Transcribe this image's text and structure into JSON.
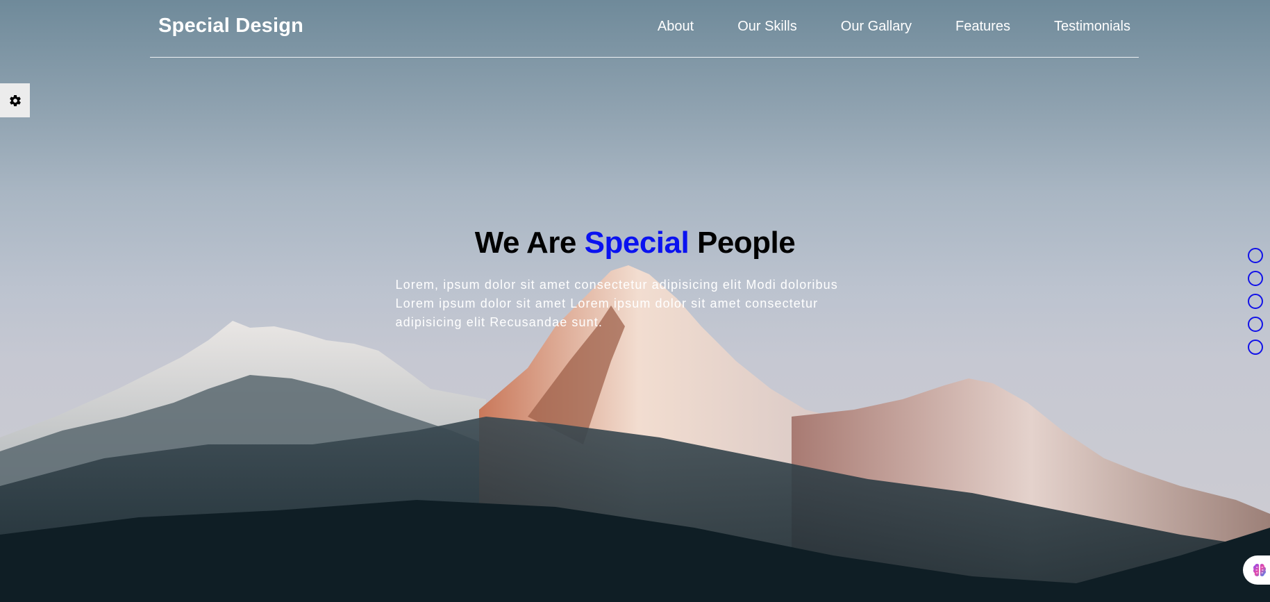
{
  "header": {
    "logo": "Special Design",
    "nav": [
      "About",
      "Our Skills",
      "Our Gallary",
      "Features",
      "Testimonials"
    ]
  },
  "settings": {
    "icon": "gear-icon"
  },
  "hero": {
    "title_part1": "We Are",
    "title_accent": "Special",
    "title_part2": "People",
    "paragraph": "Lorem, ipsum dolor sit amet consectetur adipisicing elit Modi doloribus Lorem ipsum dolor sit amet Lorem ipsum dolor sit amet consectetur adipisicing elit Recusandae sunt."
  },
  "bullets": {
    "count": 5
  },
  "assistant": {
    "icon": "brain-icon"
  },
  "colors": {
    "accent": "#0a12f0",
    "bullet": "#1212e8",
    "text_light": "#ffffff"
  }
}
